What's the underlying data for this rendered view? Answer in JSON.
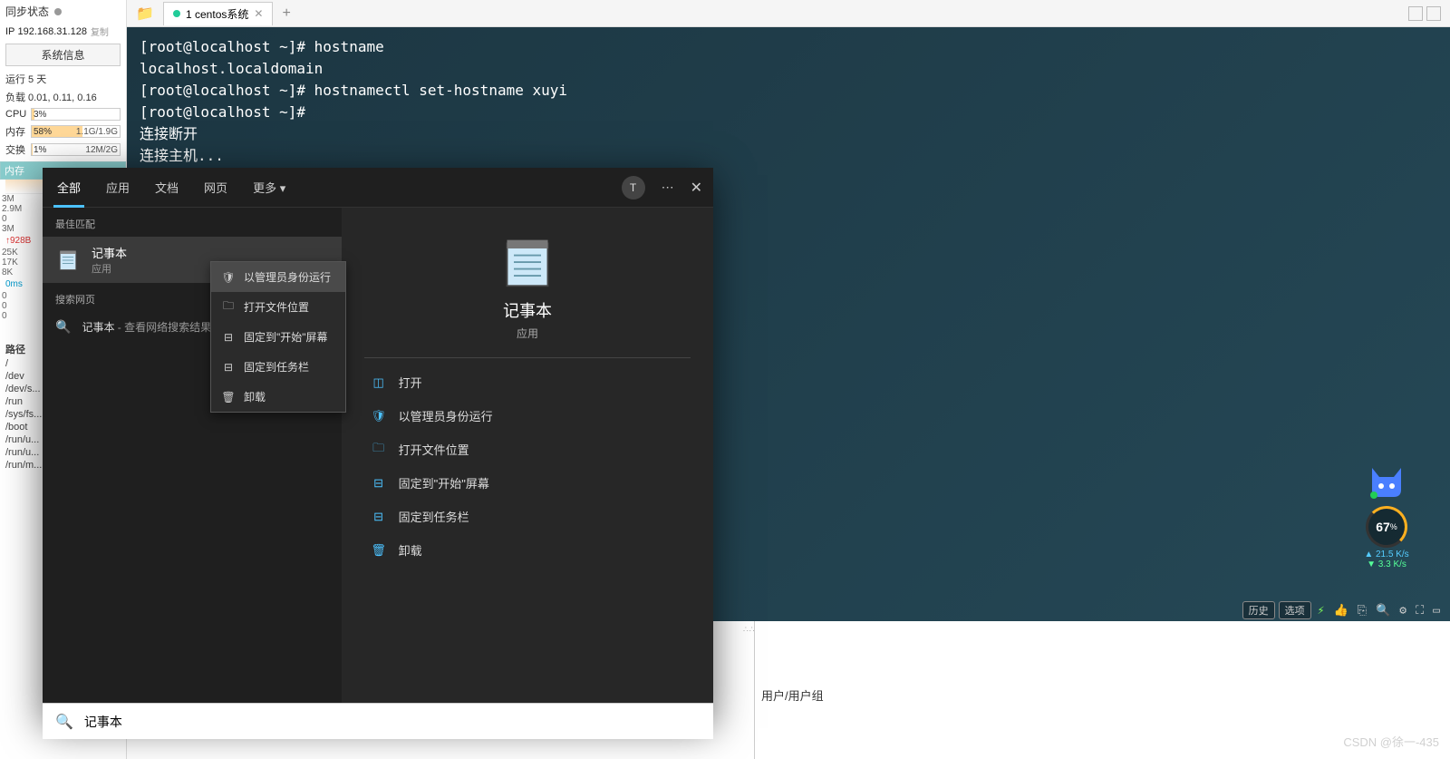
{
  "sidebar": {
    "sync_label": "同步状态",
    "ip_label": "IP",
    "ip_value": "192.168.31.128",
    "copy": "复制",
    "sysinfo_btn": "系统信息",
    "uptime": "运行 5 天",
    "load": "负载 0.01, 0.11, 0.16",
    "cpu_label": "CPU",
    "cpu_pct": "3%",
    "mem_label": "内存",
    "mem_pct": "58%",
    "mem_val": "1.1G/1.9G",
    "swap_label": "交换",
    "swap_pct": "1%",
    "swap_val": "12M/2G",
    "mem_header": "内存",
    "chart_labels": [
      "3M",
      "2.9M",
      "0",
      "3M"
    ],
    "net_up": "↑928B",
    "net_labels": [
      "25K",
      "17K",
      "8K"
    ],
    "ms": "0ms",
    "ms_vals": [
      "0",
      "0",
      "0"
    ],
    "paths_label": "路径",
    "paths": [
      "/",
      "/dev",
      "/dev/s...",
      "/run",
      "/sys/fs...",
      "/boot",
      "/run/u...",
      "/run/u...",
      "/run/m..."
    ]
  },
  "tabs": {
    "main": "1 centos系统"
  },
  "terminal": {
    "l1": "[root@localhost ~]# hostname",
    "l2": "localhost.localdomain",
    "l3": "[root@localhost ~]# hostnamectl set-hostname xuyi",
    "l4": "[root@localhost ~]# ",
    "l5": "连接断开",
    "l6": "连接主机...",
    "btn_history": "历史",
    "btn_options": "选项"
  },
  "widget": {
    "pct": "67",
    "pct_sym": "%",
    "up": "▲ 21.5 K/s",
    "dn": "▼ 3.3 K/s"
  },
  "status": {
    "label": "用户/用户组",
    "watermark": "CSDN @徐一-435"
  },
  "search": {
    "tabs": {
      "all": "全部",
      "apps": "应用",
      "docs": "文档",
      "web": "网页",
      "more": "更多"
    },
    "avatar": "T",
    "best_match": "最佳匹配",
    "item_title": "记事本",
    "item_sub": "应用",
    "web_label": "搜索网页",
    "web_item": "记事本",
    "web_sub": " - 查看网络搜索结果",
    "big_title": "记事本",
    "big_sub": "应用",
    "actions": {
      "open": "打开",
      "admin": "以管理员身份运行",
      "loc": "打开文件位置",
      "pin_start": "固定到\"开始\"屏幕",
      "pin_task": "固定到任务栏",
      "uninstall": "卸载"
    },
    "input": "记事本"
  },
  "ctx": {
    "admin": "以管理员身份运行",
    "loc": "打开文件位置",
    "pin_start": "固定到\"开始\"屏幕",
    "pin_task": "固定到任务栏",
    "uninstall": "卸载"
  }
}
